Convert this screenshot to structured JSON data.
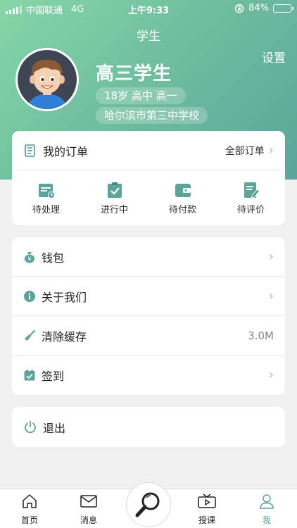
{
  "status_bar": {
    "carrier": "中国联通",
    "network": "4G",
    "time": "上午9:33",
    "battery": "84%",
    "battery_level": 0.84
  },
  "header": {
    "title": "学生",
    "settings_label": "设置"
  },
  "profile": {
    "name": "高三学生",
    "info": "18岁 高中  高一",
    "school": "哈尔滨市第三中学校"
  },
  "orders": {
    "title": "我的订单",
    "all_label": "全部订单",
    "items": [
      {
        "label": "待处理",
        "icon": "pending-calendar-icon"
      },
      {
        "label": "进行中",
        "icon": "clipboard-check-icon"
      },
      {
        "label": "待付款",
        "icon": "wallet-icon"
      },
      {
        "label": "待评价",
        "icon": "edit-note-icon"
      }
    ]
  },
  "menu": {
    "items": [
      {
        "label": "钱包",
        "icon": "money-bag-icon",
        "value": ""
      },
      {
        "label": "关于我们",
        "icon": "info-icon",
        "value": ""
      },
      {
        "label": "清除缓存",
        "icon": "broom-icon",
        "value": "3.0M"
      },
      {
        "label": "签到",
        "icon": "calendar-check-icon",
        "value": ""
      }
    ]
  },
  "logout": {
    "label": "退出",
    "icon": "power-icon"
  },
  "tabbar": {
    "tabs": [
      {
        "label": "首页",
        "icon": "home-icon"
      },
      {
        "label": "消息",
        "icon": "mail-icon"
      },
      {
        "label": "授课",
        "icon": "tv-icon"
      },
      {
        "label": "我",
        "icon": "user-icon"
      }
    ],
    "center_icon": "search-magnifier-icon",
    "active_index": 3
  },
  "colors": {
    "accent": "#5aa59a",
    "hero_start": "#86d6a8",
    "hero_end": "#5aa59a"
  }
}
